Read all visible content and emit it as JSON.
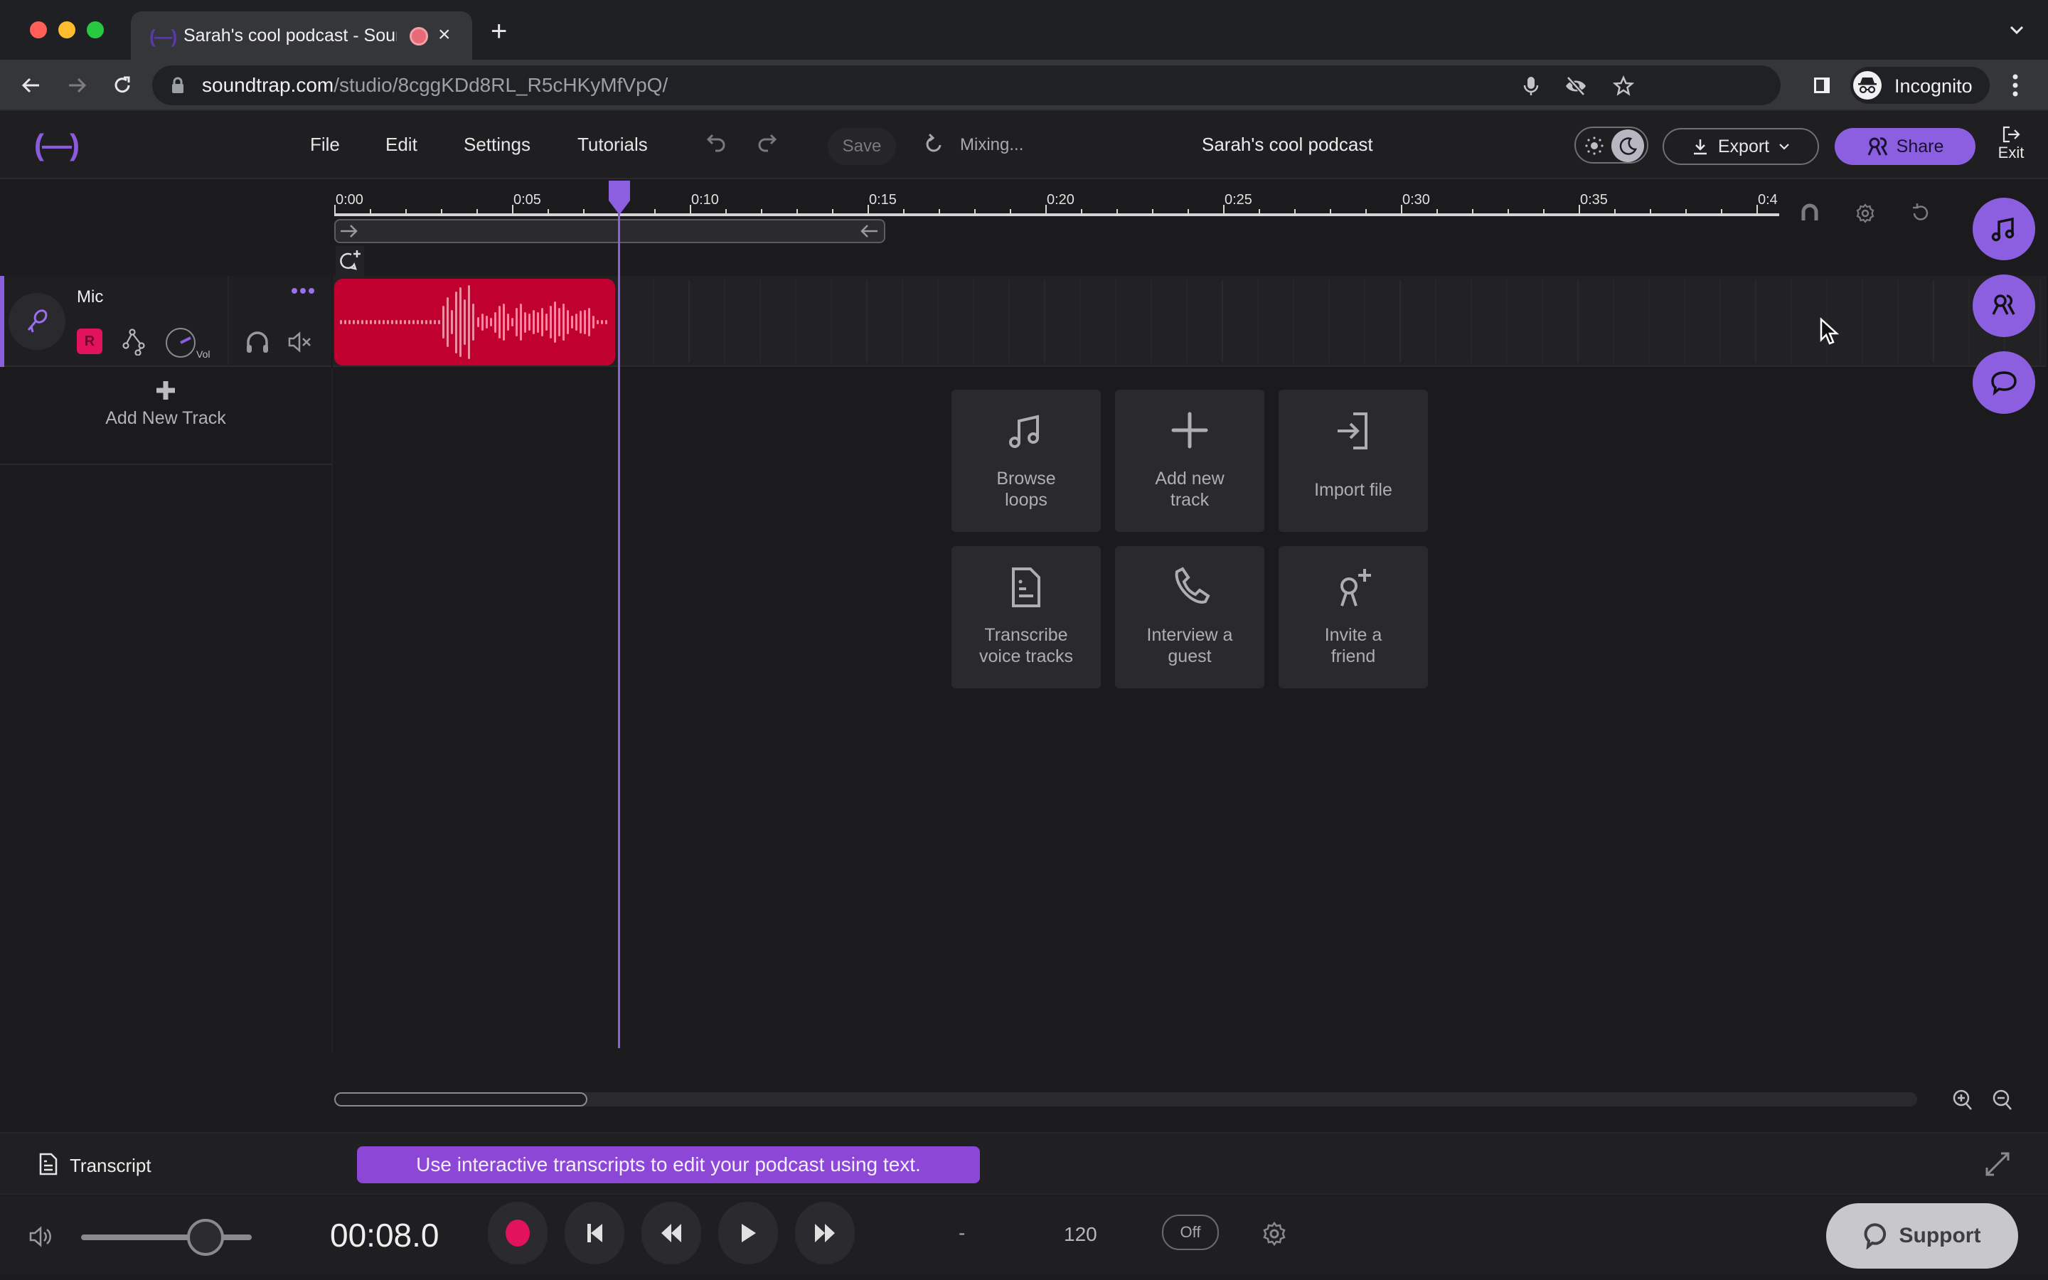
{
  "browser": {
    "tab_title": "Sarah's cool podcast - Soundtrap",
    "url_host": "soundtrap.com",
    "url_path": "/studio/8cggKDd8RL_R5cHKyMfVpQ/",
    "profile_label": "Incognito",
    "favicon": "(—)"
  },
  "header": {
    "logo": "(—)",
    "menu": [
      "File",
      "Edit",
      "Settings",
      "Tutorials"
    ],
    "save_label": "Save",
    "status_label": "Mixing...",
    "project_title": "Sarah's cool podcast",
    "theme": "dark",
    "export_label": "Export",
    "share_label": "Share",
    "exit_label": "Exit"
  },
  "timeline": {
    "tick_labels": [
      "0:00",
      "0:05",
      "0:10",
      "0:15",
      "0:20",
      "0:25",
      "0:30",
      "0:35",
      "0:4"
    ],
    "seconds_per_label": 5,
    "minor_ticks_per_label": 5,
    "loop_start_sec": 0,
    "loop_end_sec": 15.5,
    "playhead_sec": 8.0
  },
  "tracks": [
    {
      "name": "Mic",
      "record_label": "R",
      "volume_label": "Vol",
      "clip": {
        "start_sec": 0,
        "end_sec": 7.9,
        "color": "#c0002e"
      }
    }
  ],
  "add_track_label": "Add New Track",
  "quick_actions": [
    {
      "icon": "music-note-icon",
      "label": "Browse\nloops"
    },
    {
      "icon": "plus-icon",
      "label": "Add new\ntrack"
    },
    {
      "icon": "import-icon",
      "label": "Import file"
    },
    {
      "icon": "document-icon",
      "label": "Transcribe\nvoice tracks"
    },
    {
      "icon": "phone-icon",
      "label": "Interview a\nguest"
    },
    {
      "icon": "add-user-icon",
      "label": "Invite a\nfriend"
    }
  ],
  "transcript": {
    "label": "Transcript",
    "banner": "Use interactive transcripts to edit your podcast using text."
  },
  "transport": {
    "time": "00:08.0",
    "key": "-",
    "tempo": "120",
    "metronome": "Off",
    "master_volume_fraction": 0.73,
    "support_label": "Support"
  },
  "colors": {
    "accent": "#8c5fe0",
    "record": "#e3125d",
    "clip": "#c0002e",
    "banner": "#8c47d6"
  }
}
